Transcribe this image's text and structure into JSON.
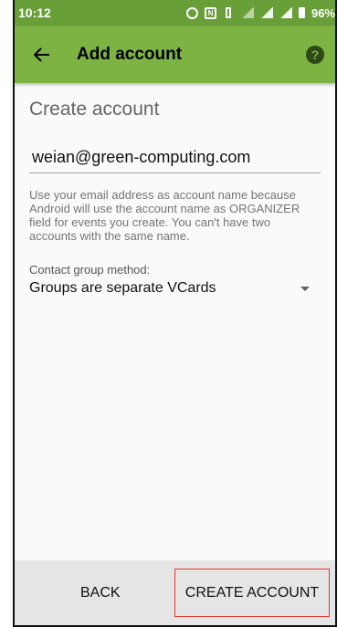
{
  "status_bar": {
    "time": "10:12",
    "battery": "96%",
    "icons": [
      "alarm-icon",
      "nfc-icon",
      "vibrate-icon",
      "mobile-data-icon",
      "signal-icon",
      "signal-icon",
      "battery-icon"
    ]
  },
  "app_bar": {
    "title": "Add account",
    "back_icon": "arrow-left",
    "help_icon": "help-circle",
    "help_glyph": "?",
    "color": "#7cb342"
  },
  "form": {
    "heading": "Create account",
    "email_value": "weian@green-computing.com",
    "note": "Use your email address as account name because Android will use the account name as ORGANIZER field for events you create. You can't have two accounts with the same name.",
    "group_method_label": "Contact group method:",
    "group_method_value": "Groups are separate VCards"
  },
  "footer": {
    "back_label": "BACK",
    "create_label": "CREATE ACCOUNT"
  }
}
